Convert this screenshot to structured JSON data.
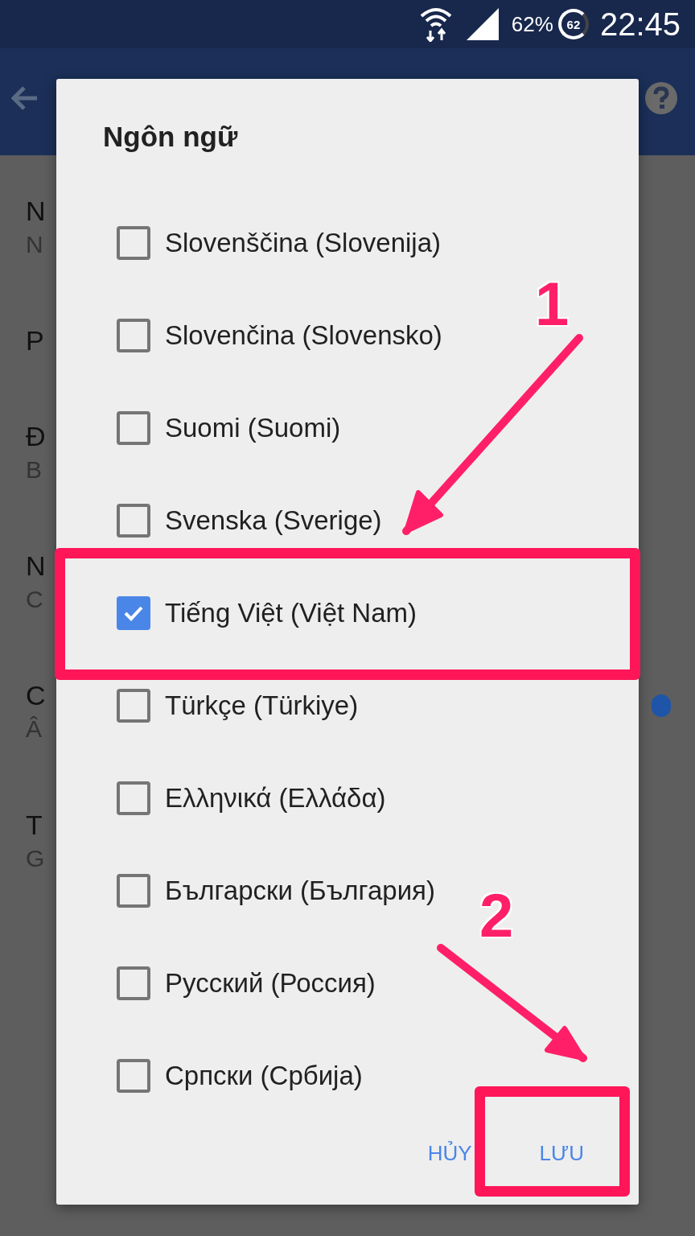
{
  "status_bar": {
    "battery_percent": "62%",
    "battery_icon_text": "62",
    "time": "22:45"
  },
  "background_settings": [
    {
      "title": "N",
      "subtitle": "N"
    },
    {
      "title": "P"
    },
    {
      "title": "Đ",
      "subtitle": "B"
    },
    {
      "title": "N",
      "subtitle": "C"
    },
    {
      "title": "C",
      "subtitle": "Â",
      "switch_on": true
    },
    {
      "title": "T",
      "subtitle": "G"
    }
  ],
  "dialog": {
    "title": "Ngôn ngữ",
    "options": [
      {
        "label": "Slovenščina (Slovenija)",
        "checked": false
      },
      {
        "label": "Slovenčina (Slovensko)",
        "checked": false
      },
      {
        "label": "Suomi (Suomi)",
        "checked": false
      },
      {
        "label": "Svenska (Sverige)",
        "checked": false
      },
      {
        "label": "Tiếng Việt (Việt Nam)",
        "checked": true
      },
      {
        "label": "Türkçe (Türkiye)",
        "checked": false
      },
      {
        "label": "Ελληνικά (Ελλάδα)",
        "checked": false
      },
      {
        "label": "Български (България)",
        "checked": false
      },
      {
        "label": "Русский (Россия)",
        "checked": false
      },
      {
        "label": "Српски (Србија)",
        "checked": false
      }
    ],
    "buttons": [
      "HỦY",
      "LƯU"
    ]
  },
  "annotations": [
    {
      "label": "1"
    },
    {
      "label": "2"
    }
  ]
}
